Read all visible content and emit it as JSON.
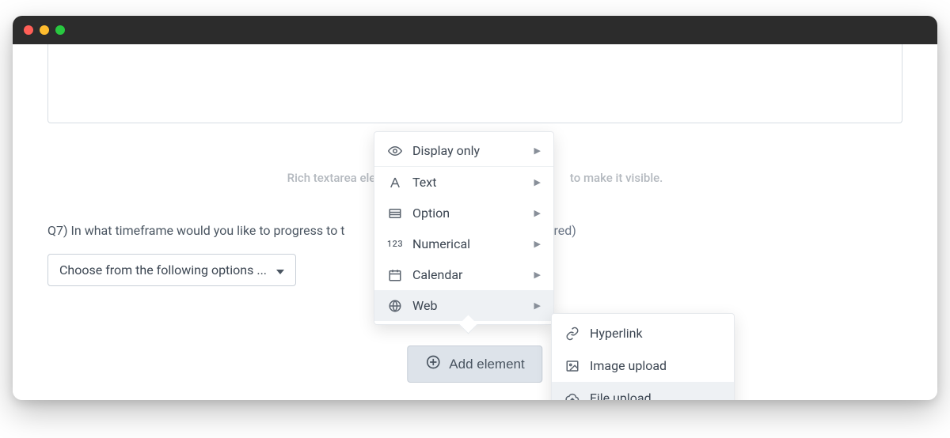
{
  "hint_left": "Rich textarea elem",
  "hint_right": "to make it visible.",
  "question_text": "Q7) In what timeframe would you like to progress to t",
  "question_required": "(required)",
  "dropdown_label": "Choose from the following options ...",
  "add_button": "Add element",
  "menu": {
    "display_only": "Display only",
    "text": "Text",
    "option": "Option",
    "numerical": "Numerical",
    "calendar": "Calendar",
    "web": "Web"
  },
  "submenu": {
    "hyperlink": "Hyperlink",
    "image_upload": "Image upload",
    "file_upload": "File upload"
  }
}
